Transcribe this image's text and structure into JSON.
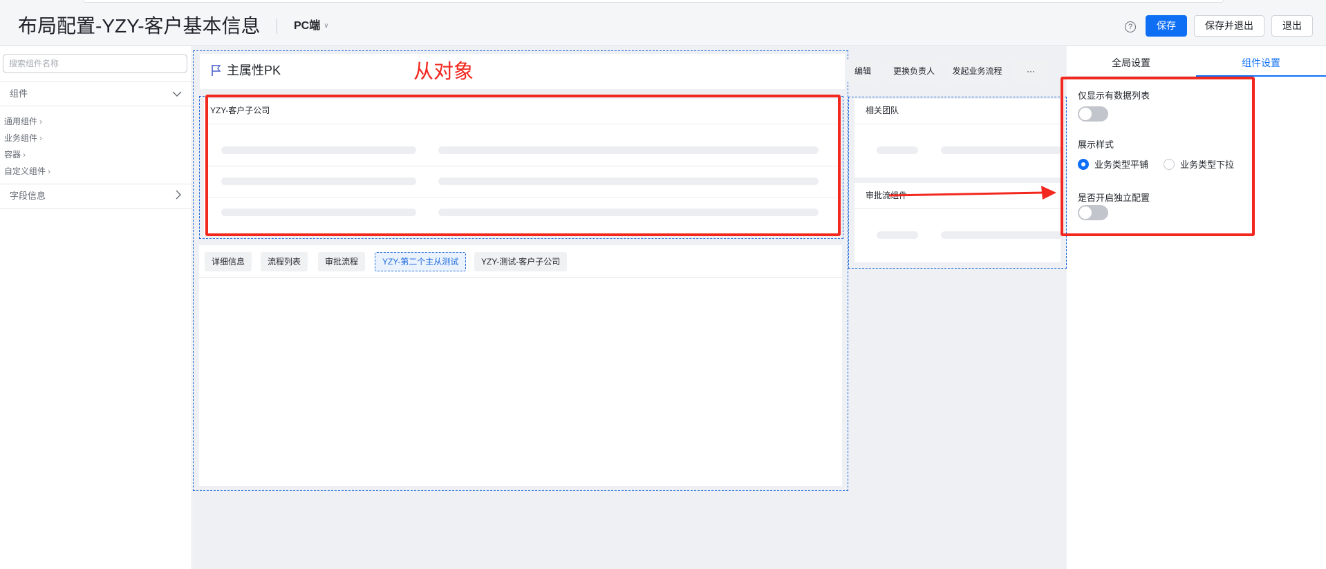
{
  "header": {
    "title": "布局配置-YZY-客户基本信息",
    "device": "PC端",
    "help_glyph": "?",
    "save_label": "保存",
    "save_exit_label": "保存并退出",
    "exit_label": "退出"
  },
  "sidebar": {
    "search_placeholder": "搜索组件名称",
    "components_label": "组件",
    "categories": [
      {
        "label": "通用组件"
      },
      {
        "label": "业务组件"
      },
      {
        "label": "容器"
      },
      {
        "label": "自定义组件"
      }
    ],
    "fields_label": "字段信息"
  },
  "canvas": {
    "object_title": "主属性PK",
    "annotation": "从对象",
    "actions": [
      {
        "label": "编辑"
      },
      {
        "label": "更换负责人"
      },
      {
        "label": "发起业务流程"
      },
      {
        "label": "···"
      }
    ],
    "detail_card_title": "YZY-客户子公司",
    "team_card_title": "相关团队",
    "approval_card_title": "审批流组件",
    "tabs": [
      {
        "label": "详细信息"
      },
      {
        "label": "流程列表"
      },
      {
        "label": "审批流程"
      },
      {
        "label": "YZY-第二个主从测试"
      },
      {
        "label": "YZY-测试-客户子公司"
      }
    ],
    "active_tab": "YZY-第二个主从测试"
  },
  "right_panel": {
    "tabs": [
      {
        "label": "全局设置"
      },
      {
        "label": "组件设置"
      }
    ],
    "active_tab": "组件设置",
    "only_data_label": "仅显示有数据列表",
    "only_data_on": false,
    "style_label": "展示样式",
    "style_options": [
      {
        "label": "业务类型平铺",
        "checked": true
      },
      {
        "label": "业务类型下拉",
        "checked": false
      }
    ],
    "independent_label": "是否开启独立配置",
    "independent_on": false
  },
  "colors": {
    "primary": "#0e6ff5",
    "annotation_red": "#f2271e",
    "dashed_blue": "#1f6bdc"
  }
}
